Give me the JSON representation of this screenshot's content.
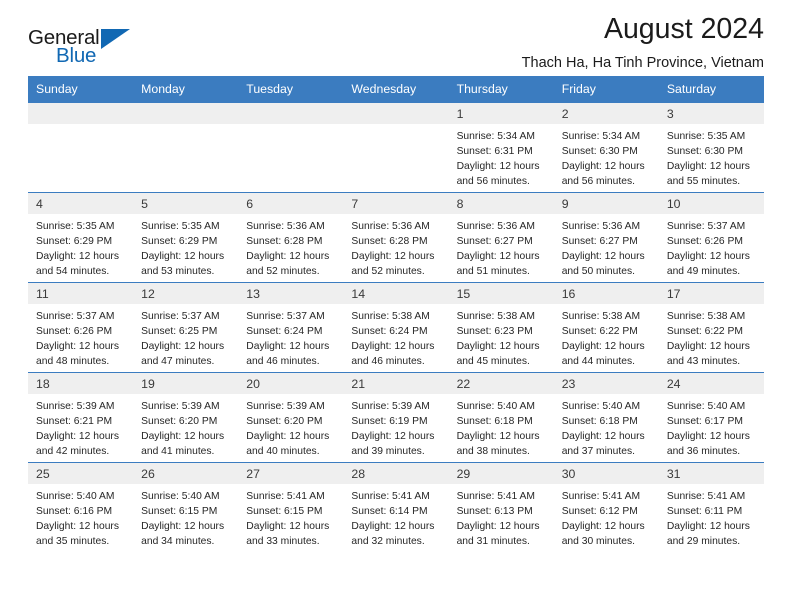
{
  "brand": {
    "name_top": "General",
    "name_bottom": "Blue"
  },
  "header": {
    "title": "August 2024",
    "subtitle": "Thach Ha, Ha Tinh Province, Vietnam"
  },
  "colors": {
    "header_blue": "#3b7cc0",
    "daynum_gray": "#efefef",
    "brand_blue": "#1168b3",
    "text": "#222222"
  },
  "weekdays": [
    "Sunday",
    "Monday",
    "Tuesday",
    "Wednesday",
    "Thursday",
    "Friday",
    "Saturday"
  ],
  "weeks": [
    [
      {
        "day": "",
        "empty": true
      },
      {
        "day": "",
        "empty": true
      },
      {
        "day": "",
        "empty": true
      },
      {
        "day": "",
        "empty": true
      },
      {
        "day": "1",
        "sunrise": "Sunrise: 5:34 AM",
        "sunset": "Sunset: 6:31 PM",
        "daylight": "Daylight: 12 hours and 56 minutes."
      },
      {
        "day": "2",
        "sunrise": "Sunrise: 5:34 AM",
        "sunset": "Sunset: 6:30 PM",
        "daylight": "Daylight: 12 hours and 56 minutes."
      },
      {
        "day": "3",
        "sunrise": "Sunrise: 5:35 AM",
        "sunset": "Sunset: 6:30 PM",
        "daylight": "Daylight: 12 hours and 55 minutes."
      }
    ],
    [
      {
        "day": "4",
        "sunrise": "Sunrise: 5:35 AM",
        "sunset": "Sunset: 6:29 PM",
        "daylight": "Daylight: 12 hours and 54 minutes."
      },
      {
        "day": "5",
        "sunrise": "Sunrise: 5:35 AM",
        "sunset": "Sunset: 6:29 PM",
        "daylight": "Daylight: 12 hours and 53 minutes."
      },
      {
        "day": "6",
        "sunrise": "Sunrise: 5:36 AM",
        "sunset": "Sunset: 6:28 PM",
        "daylight": "Daylight: 12 hours and 52 minutes."
      },
      {
        "day": "7",
        "sunrise": "Sunrise: 5:36 AM",
        "sunset": "Sunset: 6:28 PM",
        "daylight": "Daylight: 12 hours and 52 minutes."
      },
      {
        "day": "8",
        "sunrise": "Sunrise: 5:36 AM",
        "sunset": "Sunset: 6:27 PM",
        "daylight": "Daylight: 12 hours and 51 minutes."
      },
      {
        "day": "9",
        "sunrise": "Sunrise: 5:36 AM",
        "sunset": "Sunset: 6:27 PM",
        "daylight": "Daylight: 12 hours and 50 minutes."
      },
      {
        "day": "10",
        "sunrise": "Sunrise: 5:37 AM",
        "sunset": "Sunset: 6:26 PM",
        "daylight": "Daylight: 12 hours and 49 minutes."
      }
    ],
    [
      {
        "day": "11",
        "sunrise": "Sunrise: 5:37 AM",
        "sunset": "Sunset: 6:26 PM",
        "daylight": "Daylight: 12 hours and 48 minutes."
      },
      {
        "day": "12",
        "sunrise": "Sunrise: 5:37 AM",
        "sunset": "Sunset: 6:25 PM",
        "daylight": "Daylight: 12 hours and 47 minutes."
      },
      {
        "day": "13",
        "sunrise": "Sunrise: 5:37 AM",
        "sunset": "Sunset: 6:24 PM",
        "daylight": "Daylight: 12 hours and 46 minutes."
      },
      {
        "day": "14",
        "sunrise": "Sunrise: 5:38 AM",
        "sunset": "Sunset: 6:24 PM",
        "daylight": "Daylight: 12 hours and 46 minutes."
      },
      {
        "day": "15",
        "sunrise": "Sunrise: 5:38 AM",
        "sunset": "Sunset: 6:23 PM",
        "daylight": "Daylight: 12 hours and 45 minutes."
      },
      {
        "day": "16",
        "sunrise": "Sunrise: 5:38 AM",
        "sunset": "Sunset: 6:22 PM",
        "daylight": "Daylight: 12 hours and 44 minutes."
      },
      {
        "day": "17",
        "sunrise": "Sunrise: 5:38 AM",
        "sunset": "Sunset: 6:22 PM",
        "daylight": "Daylight: 12 hours and 43 minutes."
      }
    ],
    [
      {
        "day": "18",
        "sunrise": "Sunrise: 5:39 AM",
        "sunset": "Sunset: 6:21 PM",
        "daylight": "Daylight: 12 hours and 42 minutes."
      },
      {
        "day": "19",
        "sunrise": "Sunrise: 5:39 AM",
        "sunset": "Sunset: 6:20 PM",
        "daylight": "Daylight: 12 hours and 41 minutes."
      },
      {
        "day": "20",
        "sunrise": "Sunrise: 5:39 AM",
        "sunset": "Sunset: 6:20 PM",
        "daylight": "Daylight: 12 hours and 40 minutes."
      },
      {
        "day": "21",
        "sunrise": "Sunrise: 5:39 AM",
        "sunset": "Sunset: 6:19 PM",
        "daylight": "Daylight: 12 hours and 39 minutes."
      },
      {
        "day": "22",
        "sunrise": "Sunrise: 5:40 AM",
        "sunset": "Sunset: 6:18 PM",
        "daylight": "Daylight: 12 hours and 38 minutes."
      },
      {
        "day": "23",
        "sunrise": "Sunrise: 5:40 AM",
        "sunset": "Sunset: 6:18 PM",
        "daylight": "Daylight: 12 hours and 37 minutes."
      },
      {
        "day": "24",
        "sunrise": "Sunrise: 5:40 AM",
        "sunset": "Sunset: 6:17 PM",
        "daylight": "Daylight: 12 hours and 36 minutes."
      }
    ],
    [
      {
        "day": "25",
        "sunrise": "Sunrise: 5:40 AM",
        "sunset": "Sunset: 6:16 PM",
        "daylight": "Daylight: 12 hours and 35 minutes."
      },
      {
        "day": "26",
        "sunrise": "Sunrise: 5:40 AM",
        "sunset": "Sunset: 6:15 PM",
        "daylight": "Daylight: 12 hours and 34 minutes."
      },
      {
        "day": "27",
        "sunrise": "Sunrise: 5:41 AM",
        "sunset": "Sunset: 6:15 PM",
        "daylight": "Daylight: 12 hours and 33 minutes."
      },
      {
        "day": "28",
        "sunrise": "Sunrise: 5:41 AM",
        "sunset": "Sunset: 6:14 PM",
        "daylight": "Daylight: 12 hours and 32 minutes."
      },
      {
        "day": "29",
        "sunrise": "Sunrise: 5:41 AM",
        "sunset": "Sunset: 6:13 PM",
        "daylight": "Daylight: 12 hours and 31 minutes."
      },
      {
        "day": "30",
        "sunrise": "Sunrise: 5:41 AM",
        "sunset": "Sunset: 6:12 PM",
        "daylight": "Daylight: 12 hours and 30 minutes."
      },
      {
        "day": "31",
        "sunrise": "Sunrise: 5:41 AM",
        "sunset": "Sunset: 6:11 PM",
        "daylight": "Daylight: 12 hours and 29 minutes."
      }
    ]
  ]
}
